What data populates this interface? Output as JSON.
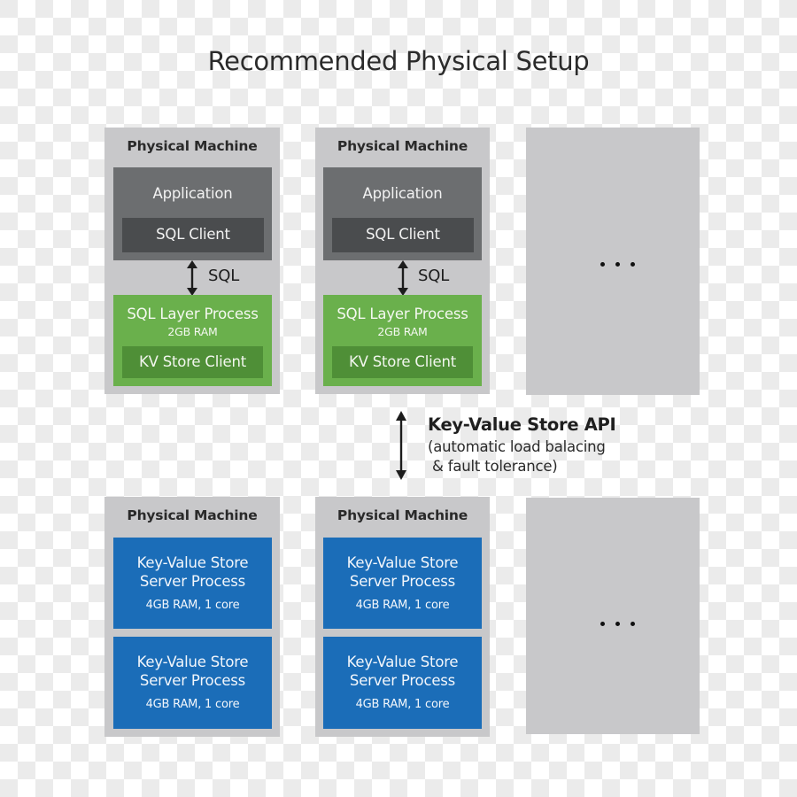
{
  "title": "Recommended Physical Setup",
  "top_row": {
    "machines": [
      {
        "label": "Physical Machine",
        "application": {
          "label": "Application",
          "client": "SQL Client"
        },
        "connector": "SQL",
        "sql_layer": {
          "title": "SQL Layer Process",
          "memory": "2GB RAM",
          "client": "KV Store Client"
        }
      },
      {
        "label": "Physical Machine",
        "application": {
          "label": "Application",
          "client": "SQL Client"
        },
        "connector": "SQL",
        "sql_layer": {
          "title": "SQL Layer Process",
          "memory": "2GB RAM",
          "client": "KV Store Client"
        }
      }
    ],
    "more": "..."
  },
  "api": {
    "title": "Key-Value Store API",
    "line1": "(automatic load balacing",
    "line2": " & fault tolerance)"
  },
  "bottom_row": {
    "machines": [
      {
        "label": "Physical Machine",
        "processes": [
          {
            "line1": "Key-Value Store",
            "line2": "Server Process",
            "spec": "4GB RAM, 1 core"
          },
          {
            "line1": "Key-Value Store",
            "line2": "Server Process",
            "spec": "4GB RAM, 1 core"
          }
        ]
      },
      {
        "label": "Physical Machine",
        "processes": [
          {
            "line1": "Key-Value Store",
            "line2": "Server Process",
            "spec": "4GB RAM, 1 core"
          },
          {
            "line1": "Key-Value Store",
            "line2": "Server Process",
            "spec": "4GB RAM, 1 core"
          }
        ]
      }
    ],
    "more": "..."
  },
  "colors": {
    "machine": "#c8c8ca",
    "application": "#6c6e70",
    "sql_client": "#4a4c4e",
    "sql_layer": "#6ab04c",
    "kv_client": "#4f8f37",
    "kv_server": "#1b6db8"
  }
}
